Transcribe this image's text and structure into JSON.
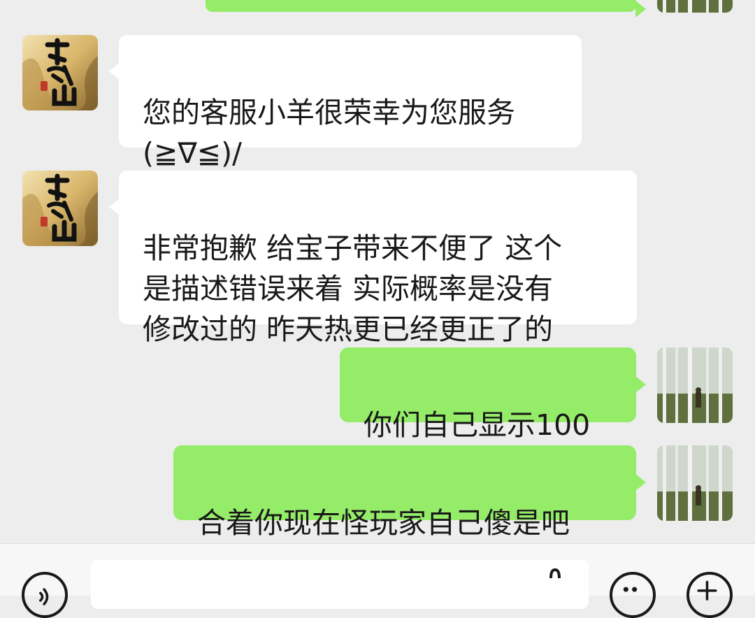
{
  "messages": [
    {
      "side": "out",
      "text": ""
    },
    {
      "side": "in",
      "text": "您的客服小羊很荣幸为您服务\n(≧∇≦)/"
    },
    {
      "side": "in",
      "text": "非常抱歉 给宝子带来不便了 这个\n是描述错误来着 实际概率是没有\n修改过的  昨天热更已经更正了的"
    },
    {
      "side": "out",
      "text": "你们自己显示100"
    },
    {
      "side": "out",
      "text": "合着你现在怪玩家自己傻是吧"
    }
  ],
  "avatars": {
    "agent": "game-logo-avatar",
    "user": "birch-forest-photo-avatar"
  },
  "input_bar": {
    "voice_icon": "voice-icon",
    "message_value": "",
    "emoji_icon": "emoji-icon",
    "more_icon": "plus-icon"
  },
  "colors": {
    "background": "#ededed",
    "incoming_bubble": "#ffffff",
    "outgoing_bubble": "#95ec69",
    "text": "#191919"
  }
}
